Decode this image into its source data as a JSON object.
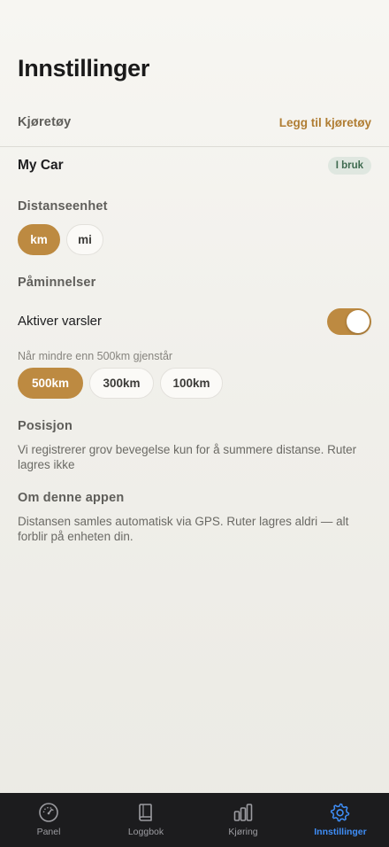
{
  "header": {
    "title": "Innstillinger"
  },
  "vehicles": {
    "heading": "Kjøretøy",
    "add_label": "Legg til kjøretøy",
    "items": [
      {
        "name": "My Car",
        "badge": "I bruk"
      }
    ]
  },
  "distance_unit": {
    "heading": "Distanseenhet",
    "options": [
      "km",
      "mi"
    ],
    "selected": "km"
  },
  "reminders": {
    "heading": "Påminnelser",
    "toggle_label": "Aktiver varsler",
    "toggle_on": true,
    "hint": "Når mindre enn 500km gjenstår",
    "options": [
      "500km",
      "300km",
      "100km"
    ],
    "selected": "500km"
  },
  "position": {
    "heading": "Posisjon",
    "text": "Vi registrerer grov bevegelse kun for å summere distanse. Ruter lagres ikke"
  },
  "about": {
    "heading": "Om denne appen",
    "text": "Distansen samles automatisk via GPS. Ruter lagres aldri — alt forblir på enheten din."
  },
  "tabbar": {
    "items": [
      {
        "label": "Panel",
        "icon": "gauge-icon"
      },
      {
        "label": "Loggbok",
        "icon": "book-icon"
      },
      {
        "label": "Kjøring",
        "icon": "bar-chart-icon"
      },
      {
        "label": "Innstillinger",
        "icon": "gear-icon"
      }
    ],
    "active_index": 3
  },
  "colors": {
    "accent": "#bd8a41",
    "link": "#b07d33",
    "tab_active": "#3f8ef7",
    "badge_bg": "#dfe7e0",
    "badge_text": "#3e6a4f"
  }
}
